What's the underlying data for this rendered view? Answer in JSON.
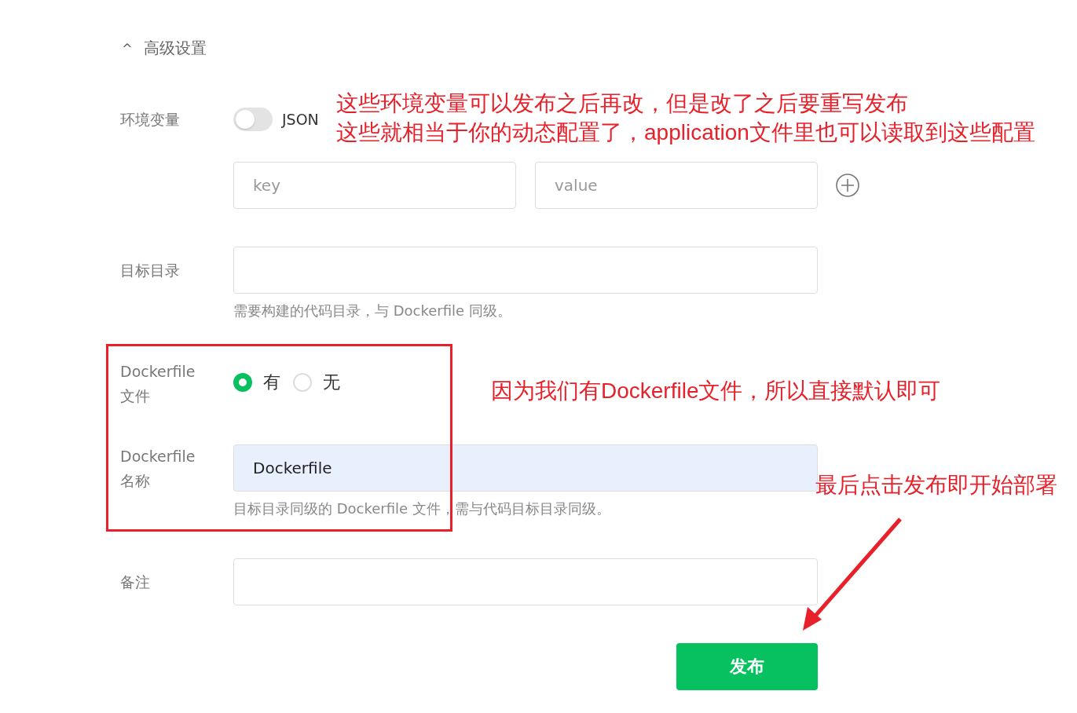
{
  "section": {
    "caret": "^",
    "title": "高级设置",
    "expanded": true
  },
  "env": {
    "label": "环境变量",
    "json_toggle": {
      "on": false,
      "label": "JSON"
    },
    "key_placeholder": "key",
    "value_placeholder": "value"
  },
  "target_dir": {
    "label": "目标目录",
    "help": "需要构建的代码目录，与 Dockerfile 同级。"
  },
  "dockerfile": {
    "label": "Dockerfile 文件",
    "options": [
      {
        "label": "有",
        "selected": true
      },
      {
        "label": "无",
        "selected": false
      }
    ]
  },
  "dockerfile_name": {
    "label": "Dockerfile 名称",
    "value": "Dockerfile",
    "help": "目标目录同级的 Dockerfile 文件，需与代码目标目录同级。"
  },
  "notes": {
    "label": "备注"
  },
  "submit": {
    "label": "发布"
  },
  "annotations": [
    {
      "kind": "note",
      "lines": [
        "这些环境变量可以发布之后再改，但是改了之后要重写发布",
        "这些就相当于你的动态配置了，application文件里也可以读取到这些配置"
      ]
    },
    {
      "kind": "note",
      "lines": [
        "因为我们有Dockerfile文件，所以直接默认即可"
      ]
    },
    {
      "kind": "note",
      "lines": [
        "最后点击发布即开始部署"
      ]
    }
  ]
}
